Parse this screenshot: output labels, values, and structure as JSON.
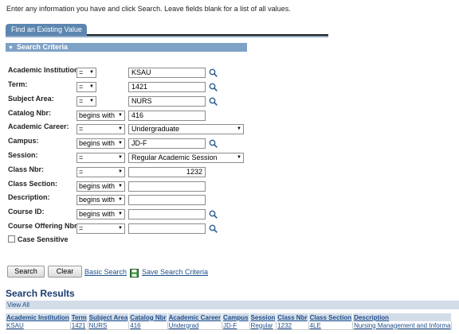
{
  "intro_text": "Enter any information you have and click Search. Leave fields blank for a list of all values.",
  "tab_label": "Find an Existing Value",
  "section_title": "Search Criteria",
  "fields": [
    {
      "label": "Academic Institution:",
      "op": "=",
      "value": "KSAU",
      "lookup": true,
      "type": "text"
    },
    {
      "label": "Term:",
      "op": "=",
      "value": "1421",
      "lookup": true,
      "type": "text"
    },
    {
      "label": "Subject Area:",
      "op": "=",
      "value": "NURS",
      "lookup": true,
      "type": "text"
    },
    {
      "label": "Catalog Nbr:",
      "op": "begins with",
      "value": "416",
      "lookup": false,
      "type": "text"
    },
    {
      "label": "Academic Career:",
      "op": "=",
      "value": "Undergraduate",
      "lookup": false,
      "type": "select"
    },
    {
      "label": "Campus:",
      "op": "begins with",
      "value": "JD-F",
      "lookup": true,
      "type": "text"
    },
    {
      "label": "Session:",
      "op": "=",
      "value": "Regular Academic Session",
      "lookup": false,
      "type": "select"
    },
    {
      "label": "Class Nbr:",
      "op": "=",
      "value": "1232",
      "lookup": false,
      "type": "number"
    },
    {
      "label": "Class Section:",
      "op": "begins with",
      "value": "",
      "lookup": false,
      "type": "text"
    },
    {
      "label": "Description:",
      "op": "begins with",
      "value": "",
      "lookup": false,
      "type": "text"
    },
    {
      "label": "Course ID:",
      "op": "begins with",
      "value": "",
      "lookup": true,
      "type": "text"
    },
    {
      "label": "Course Offering Nbr:",
      "op": "=",
      "value": "",
      "lookup": true,
      "type": "text"
    }
  ],
  "case_sensitive_label": "Case Sensitive",
  "buttons": {
    "search": "Search",
    "clear": "Clear"
  },
  "links": {
    "basic_search": "Basic Search",
    "save_search": "Save Search Criteria"
  },
  "results": {
    "title": "Search Results",
    "view_all": "View All",
    "columns": [
      "Academic Institution",
      "Term",
      "Subject Area",
      "Catalog Nbr",
      "Academic Career",
      "Campus",
      "Session",
      "Class Nbr",
      "Class Section",
      "Description"
    ],
    "rows": [
      [
        "KSAU",
        "1421",
        "NURS",
        "416",
        "Undergrad",
        "JD-F",
        "Regular",
        "1232",
        "4LE",
        "Nursing Management and Informa"
      ]
    ]
  },
  "colors": {
    "tab": "#5c86b0",
    "section_bar": "#7ea1c6",
    "link": "#1f4e8c",
    "header_bg": "#d3dde8"
  }
}
